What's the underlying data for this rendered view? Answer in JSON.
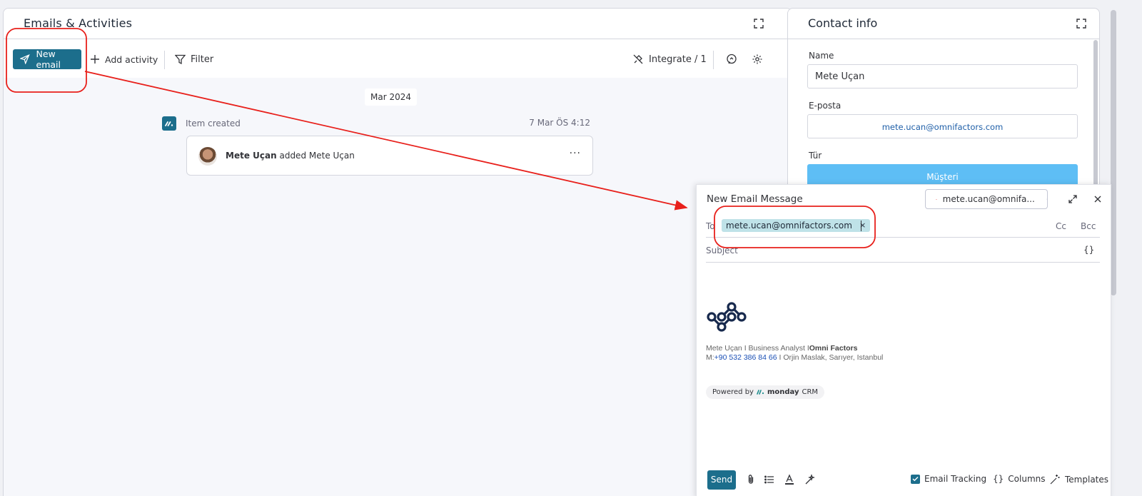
{
  "left_panel": {
    "title": "Emails & Activities",
    "toolbar": {
      "new_email": "New email",
      "add_activity": "Add activity",
      "filter": "Filter",
      "integrate": "Integrate / 1"
    },
    "date_chip": "Mar 2024",
    "activity": {
      "label": "Item created",
      "time": "7 Mar ÖS 4:12",
      "actor": "Mete Uçan",
      "action": "added Mete Uçan",
      "more": "···"
    }
  },
  "right_panel": {
    "title": "Contact info",
    "fields": {
      "name_label": "Name",
      "name_value": "Mete Uçan",
      "email_label": "E-posta",
      "email_value": "mete.ucan@omnifactors.com",
      "type_label": "Tür",
      "type_value": "Müşteri"
    },
    "colors": {
      "type_badge": "#5ebef5",
      "email_link": "#1f5fa8"
    }
  },
  "compose": {
    "title": "New Email Message",
    "account": "mete.ucan@omnifa...",
    "to_label": "To",
    "recipient": "mete.ucan@omnifactors.com",
    "recipient_remove": "×",
    "cc": "Cc",
    "bcc": "Bcc",
    "subject_placeholder": "Subject",
    "variables_icon": "{}",
    "signature": {
      "name_part": "Mete Uçan I Business Analyst I",
      "company": "Omni Factors",
      "phone_prefix": "M:",
      "phone": "+90 532 386 84 66",
      "address": "I Orjin Maslak, Sarıyer, Istanbul"
    },
    "powered_by": "Powered by",
    "powered_brand": "monday",
    "powered_suffix": "CRM",
    "footer": {
      "send": "Send",
      "email_tracking": "Email Tracking",
      "columns": "Columns",
      "templates": "Templates"
    }
  },
  "colors": {
    "accent": "#1c6e8c",
    "annotation": "#e8201b"
  }
}
